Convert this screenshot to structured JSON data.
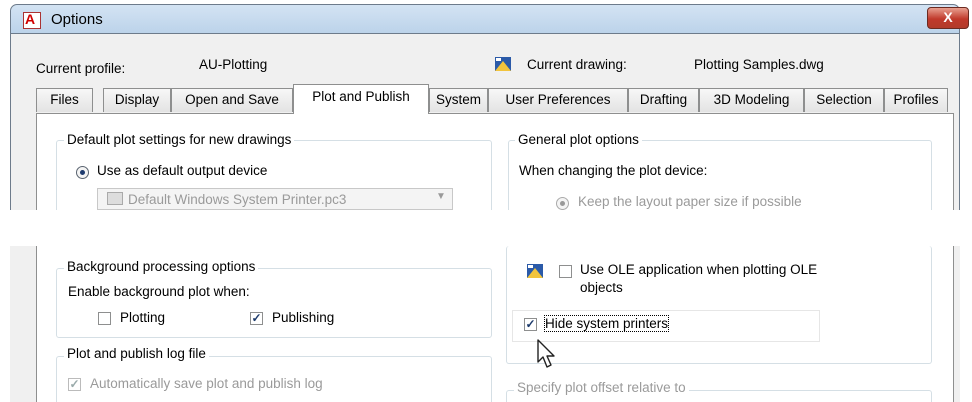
{
  "window": {
    "title": "Options",
    "close_label": "X"
  },
  "header": {
    "current_profile_label": "Current profile:",
    "current_profile_value": "AU-Plotting",
    "current_drawing_label": "Current drawing:",
    "current_drawing_value": "Plotting Samples.dwg"
  },
  "tabs": [
    {
      "label": "Files"
    },
    {
      "label": "Display"
    },
    {
      "label": "Open and Save"
    },
    {
      "label": "Plot and Publish",
      "active": true
    },
    {
      "label": "System"
    },
    {
      "label": "User Preferences"
    },
    {
      "label": "Drafting"
    },
    {
      "label": "3D Modeling"
    },
    {
      "label": "Selection"
    },
    {
      "label": "Profiles"
    }
  ],
  "default_plot": {
    "legend": "Default plot settings for new drawings",
    "use_default_label": "Use as default output device",
    "device_value": "Default Windows System Printer.pc3"
  },
  "general_plot": {
    "legend": "General plot options",
    "when_changing_label": "When changing the plot device:",
    "keep_layout_label": "Keep the layout paper size if possible"
  },
  "background": {
    "legend": "Background processing options",
    "enable_label": "Enable background plot when:",
    "plotting_label": "Plotting",
    "plotting_checked": false,
    "publishing_label": "Publishing",
    "publishing_checked": true
  },
  "log": {
    "legend": "Plot and publish log file",
    "auto_save_label": "Automatically save plot and publish log",
    "auto_save_checked": true
  },
  "ole": {
    "label": "Use OLE application when plotting OLE",
    "label_line2": "objects",
    "checked": false
  },
  "hide_printers": {
    "label": "Hide system printers",
    "checked": true
  },
  "offset": {
    "legend": "Specify plot offset relative to"
  },
  "colors": {
    "accent": "#1e3b6e",
    "titlebar": "#c8dbef",
    "close": "#c0392b"
  }
}
